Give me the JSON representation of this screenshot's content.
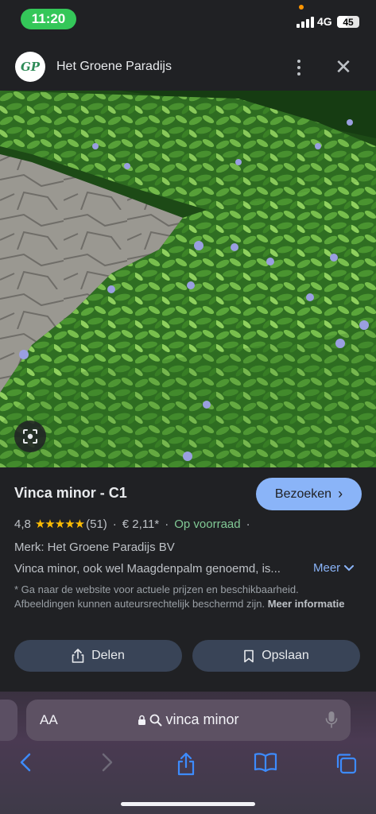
{
  "status_bar": {
    "time": "11:20",
    "network": "4G",
    "battery": "45",
    "battery_level": 0.45
  },
  "header": {
    "site_name": "Het Groene Paradijs",
    "logo_text": "GP"
  },
  "product": {
    "title": "Vinca minor - C1",
    "visit_label": "Bezoeken",
    "rating": "4,8",
    "stars": "★★★★★",
    "star_value": 4.8,
    "review_count": "(51)",
    "price": "€ 2,11*",
    "availability": "Op voorraad",
    "brand": "Merk: Het Groene Paradijs BV",
    "description": "Vinca minor, ook wel Maagdenpalm genoemd, is...",
    "more_label": "Meer",
    "disclaimer": "* Ga naar de website voor actuele prijzen en beschikbaarheid. Afbeeldingen kunnen auteursrechtelijk beschermd zijn.",
    "more_info_label": "Meer informatie"
  },
  "actions": {
    "share_label": "Delen",
    "save_label": "Opslaan"
  },
  "browser": {
    "aa_label": "AA",
    "url_text": "vinca minor"
  },
  "colors": {
    "accent": "#8ab4f8",
    "status_green": "#34c759",
    "in_stock": "#81c995",
    "star": "#fbbc04"
  }
}
